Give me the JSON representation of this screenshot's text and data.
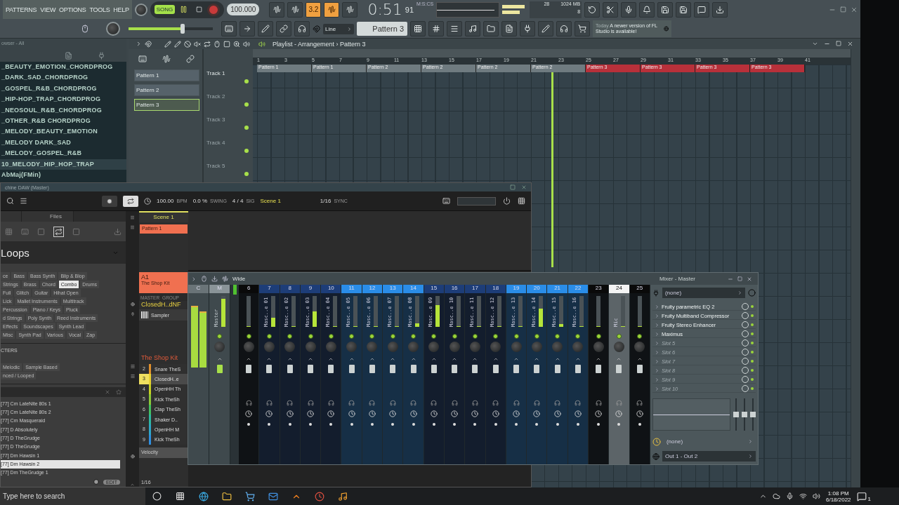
{
  "menu": [
    "PATTERNS",
    "VIEW",
    "OPTIONS",
    "TOOLS",
    "HELP"
  ],
  "transport": {
    "song_label": "SONG",
    "song_mode": true,
    "tempo": "100.000",
    "time": "0:51",
    "time_sub": "91",
    "time_unit": "M:S:CS",
    "cpu": "28",
    "memory": "1024 MB",
    "polyphony": "8"
  },
  "toggles": [
    {
      "on": false
    },
    {
      "on": false
    },
    {
      "label": "3.2",
      "on": true
    },
    {
      "on": true
    },
    {
      "on": false
    }
  ],
  "volume": {
    "level": 0.64
  },
  "snap": "Line",
  "pattern": "Pattern 3",
  "news": {
    "date": "Today",
    "text": "A newer version of FL Studio is available!"
  },
  "browser": {
    "title": "owser - All",
    "items": [
      {
        "label": "_BEAUTY_EMOTION_CHORDPROG",
        "selected": false
      },
      {
        "label": "_DARK_SAD_CHORDPROG",
        "selected": false
      },
      {
        "label": "_GOSPEL_R&B_CHORDPROG",
        "selected": false
      },
      {
        "label": "_HIP-HOP_TRAP_CHORDPROG",
        "selected": false
      },
      {
        "label": "_NEOSOUL_R&B_CHORDPROG",
        "selected": false
      },
      {
        "label": "_OTHER_R&B CHORDPROG",
        "selected": false
      },
      {
        "label": "_MELODY_BEAUTY_EMOTION",
        "selected": false
      },
      {
        "label": "_MELODY DARK_SAD",
        "selected": false
      },
      {
        "label": "_MELODY_GOSPEL_R&B",
        "selected": false
      },
      {
        "label": "10_MELODY_HIP_HOP_TRAP",
        "selected": true
      },
      {
        "label": "AbMaj(FMin)",
        "selected": false
      }
    ]
  },
  "playlist": {
    "title": "Playlist - Arrangement › Pattern 3",
    "patterns": [
      {
        "label": "Pattern 1",
        "selected": false
      },
      {
        "label": "Pattern 2",
        "selected": false
      },
      {
        "label": "Pattern 3",
        "selected": true
      }
    ],
    "tracks": [
      "Track 1",
      "Track 2",
      "Track 3",
      "Track 4",
      "Track 5"
    ],
    "bars": [
      "1",
      "3",
      "5",
      "7",
      "9",
      "11",
      "13",
      "15",
      "17",
      "19",
      "21",
      "23",
      "25",
      "27",
      "29",
      "31",
      "33",
      "35",
      "37",
      "39",
      "41"
    ],
    "clips": [
      {
        "label": "Pattern 1",
        "color": "#6f7b80"
      },
      {
        "label": "Pattern 1",
        "color": "#6f7b80"
      },
      {
        "label": "Pattern 2",
        "color": "#6f7b80"
      },
      {
        "label": "Pattern 2",
        "color": "#6f7b80"
      },
      {
        "label": "Pattern 2",
        "color": "#6f7b80"
      },
      {
        "label": "Pattern 2",
        "color": "#6f7b80"
      },
      {
        "label": "Pattern 3",
        "color": "#b8303a"
      },
      {
        "label": "Pattern 3",
        "color": "#b8303a"
      },
      {
        "label": "Pattern 3",
        "color": "#b8303a"
      },
      {
        "label": "Pattern 3",
        "color": "#b8303a"
      }
    ]
  },
  "maschine": {
    "title": "chine DAW (Master)",
    "tempo": "100.00",
    "tempo_unit": "BPM",
    "swing": "0.0 %",
    "swing_unit": "SWING",
    "signature": "4 / 4",
    "signature_unit": "SIG",
    "scene": "Scene 1",
    "grid": "1/16",
    "sync": "SYNC",
    "tab": "Files",
    "heading": "Loops",
    "tag_rows": [
      [
        {
          "label": "ce",
          "selected": false
        },
        {
          "label": "Bass",
          "selected": false
        },
        {
          "label": "Bass Synth",
          "selected": false
        },
        {
          "label": "Blip & Blop",
          "selected": false
        }
      ],
      [
        {
          "label": "Strings",
          "selected": false
        },
        {
          "label": "Brass",
          "selected": false
        },
        {
          "label": "Chord",
          "selected": false
        },
        {
          "label": "Combo",
          "selected": true
        },
        {
          "label": "Drums",
          "selected": false
        }
      ],
      [
        {
          "label": "Full",
          "selected": false
        },
        {
          "label": "Glitch",
          "selected": false
        },
        {
          "label": "Guitar",
          "selected": false
        },
        {
          "label": "Hihat Open",
          "selected": false
        }
      ],
      [
        {
          "label": "Lick",
          "selected": false
        },
        {
          "label": "Mallet Instruments",
          "selected": false
        },
        {
          "label": "Multitrack",
          "selected": false
        }
      ],
      [
        {
          "label": "Percussion",
          "selected": false
        },
        {
          "label": "Piano / Keys",
          "selected": false
        },
        {
          "label": "Pluck",
          "selected": false
        }
      ],
      [
        {
          "label": "d Strings",
          "selected": false
        },
        {
          "label": "Poly Synth",
          "selected": false
        },
        {
          "label": "Reed Instruments",
          "selected": false
        }
      ],
      [
        {
          "label": "Effects",
          "selected": false
        },
        {
          "label": "Soundscapes",
          "selected": false
        },
        {
          "label": "Synth Lead",
          "selected": false
        }
      ],
      [
        {
          "label": "Misc",
          "selected": false
        },
        {
          "label": "Synth Pad",
          "selected": false
        },
        {
          "label": "Various",
          "selected": false
        },
        {
          "label": "Vocal",
          "selected": false
        },
        {
          "label": "Zap",
          "selected": false
        }
      ]
    ],
    "characters_title": "CTERS",
    "character_rows": [
      [
        {
          "label": "Melodic",
          "selected": false
        },
        {
          "label": "Sample Based",
          "selected": false
        }
      ],
      [
        {
          "label": "nced / Looped",
          "selected": false
        }
      ]
    ],
    "results": [
      {
        "label": "[77] Cm LateNite 80s 1",
        "selected": false
      },
      {
        "label": "[77] Cm LateNite 80s 2",
        "selected": false
      },
      {
        "label": "[77] Cm Masqueraid",
        "selected": false
      },
      {
        "label": "[77] D Absolutely",
        "selected": false
      },
      {
        "label": "[77] D TheGrudge",
        "selected": false
      },
      {
        "label": "[77] D TheGrudge",
        "selected": false
      },
      {
        "label": "[77] Dm Hawsin 1",
        "selected": false
      },
      {
        "label": "[77] Dm Hawsin 2",
        "selected": true
      },
      {
        "label": "[77] Dm TheGrudge 1",
        "selected": false
      }
    ],
    "edit": "EDIT",
    "scene_header": "Scene 1",
    "scene_pattern": "Pattern 1",
    "group_id": "A1",
    "group_name": "The Shop Kit",
    "group_tabs": [
      "MASTER",
      "GROUP"
    ],
    "sound_title": "ClosedH..dNF",
    "module": "Sampler",
    "kit_title": "The Shop Kit",
    "sounds": [
      {
        "num": "2",
        "name": "Snare TheS",
        "color": "#e0902c",
        "selected": false
      },
      {
        "num": "3",
        "name": "ClosedH..e",
        "color": "#e8d030",
        "selected": true
      },
      {
        "num": "4",
        "name": "OpenHH Th",
        "color": "#c8d024",
        "selected": false
      },
      {
        "num": "5",
        "name": "Kick TheSh",
        "color": "#8cc838",
        "selected": false
      },
      {
        "num": "6",
        "name": "Clap TheSh",
        "color": "#44c060",
        "selected": false
      },
      {
        "num": "7",
        "name": "Shaker D..",
        "color": "#30b8a0",
        "selected": false
      },
      {
        "num": "8",
        "name": "OpenHH M",
        "color": "#30a8c8",
        "selected": false
      },
      {
        "num": "9",
        "name": "Kick TheSh",
        "color": "#3090e0",
        "selected": false
      }
    ],
    "lane": "Velocity",
    "step": "1/16"
  },
  "mixer": {
    "title": "Mixer - Master",
    "stereo": "Wide",
    "master_labels": [
      "C",
      "M"
    ],
    "master_name": "Master",
    "tracks": [
      {
        "num": "6",
        "color": "#0a0a0a",
        "selected": false,
        "level": 0
      },
      {
        "num": "7",
        "name": "Masc..e 01",
        "color": "#1d3d78",
        "selected": false,
        "level": 0.3
      },
      {
        "num": "8",
        "name": "Masc..e 02",
        "color": "#1d3d78",
        "selected": false,
        "level": 0
      },
      {
        "num": "9",
        "name": "Masc..e 03",
        "color": "#1d3d78",
        "selected": false,
        "level": 0.5
      },
      {
        "num": "10",
        "name": "Masc..e 04",
        "color": "#1d3d78",
        "selected": false,
        "level": 0
      },
      {
        "num": "11",
        "name": "Masc..e 05",
        "color": "#2a8de8",
        "selected": false,
        "level": 0
      },
      {
        "num": "12",
        "name": "Masc..e 06",
        "color": "#2a8de8",
        "selected": false,
        "level": 0
      },
      {
        "num": "13",
        "name": "Masc..e 07",
        "color": "#2a8de8",
        "selected": false,
        "level": 0
      },
      {
        "num": "14",
        "name": "Masc..e 08",
        "color": "#2a8de8",
        "selected": false,
        "level": 0.12
      },
      {
        "num": "15",
        "name": "Masc..e 09",
        "color": "#1d3d78",
        "selected": false,
        "level": 0.7
      },
      {
        "num": "16",
        "name": "Masc..e 10",
        "color": "#1d3d78",
        "selected": false,
        "level": 0
      },
      {
        "num": "17",
        "name": "Masc..e 11",
        "color": "#1d3d78",
        "selected": false,
        "level": 0
      },
      {
        "num": "18",
        "name": "Masc..e 12",
        "color": "#1d3d78",
        "selected": false,
        "level": 0
      },
      {
        "num": "19",
        "name": "Masc..e 13",
        "color": "#2a8de8",
        "selected": false,
        "level": 0
      },
      {
        "num": "20",
        "name": "Masc..e 14",
        "color": "#2a8de8",
        "selected": false,
        "level": 0.6
      },
      {
        "num": "21",
        "name": "Masc..e 15",
        "color": "#2a8de8",
        "selected": false,
        "level": 0.08
      },
      {
        "num": "22",
        "name": "Masc..e 16",
        "color": "#2a8de8",
        "selected": false,
        "level": 0
      },
      {
        "num": "23",
        "color": "#0a0a0a",
        "selected": false,
        "level": 0
      },
      {
        "num": "24",
        "name": "Mic",
        "selected": true,
        "level": 0
      },
      {
        "num": "25",
        "color": "#0a0a0a",
        "selected": false,
        "level": 0
      }
    ],
    "input": "(none)",
    "slots": [
      {
        "name": "Fruity parametric EQ 2",
        "empty": false
      },
      {
        "name": "Fruity Multiband Compressor",
        "empty": false
      },
      {
        "name": "Fruity Stereo Enhancer",
        "empty": false
      },
      {
        "name": "Maximus",
        "empty": false
      },
      {
        "name": "Slot 5",
        "empty": true
      },
      {
        "name": "Slot 6",
        "empty": true
      },
      {
        "name": "Slot 7",
        "empty": true
      },
      {
        "name": "Slot 8",
        "empty": true
      },
      {
        "name": "Slot 9",
        "empty": true
      },
      {
        "name": "Slot 10",
        "empty": true
      }
    ],
    "send": "(none)",
    "output": "Out 1 - Out 2"
  },
  "taskbar": {
    "search_placeholder": "Type here to search",
    "time": "1:08 PM",
    "date": "6/18/2022",
    "notifications": "1"
  }
}
